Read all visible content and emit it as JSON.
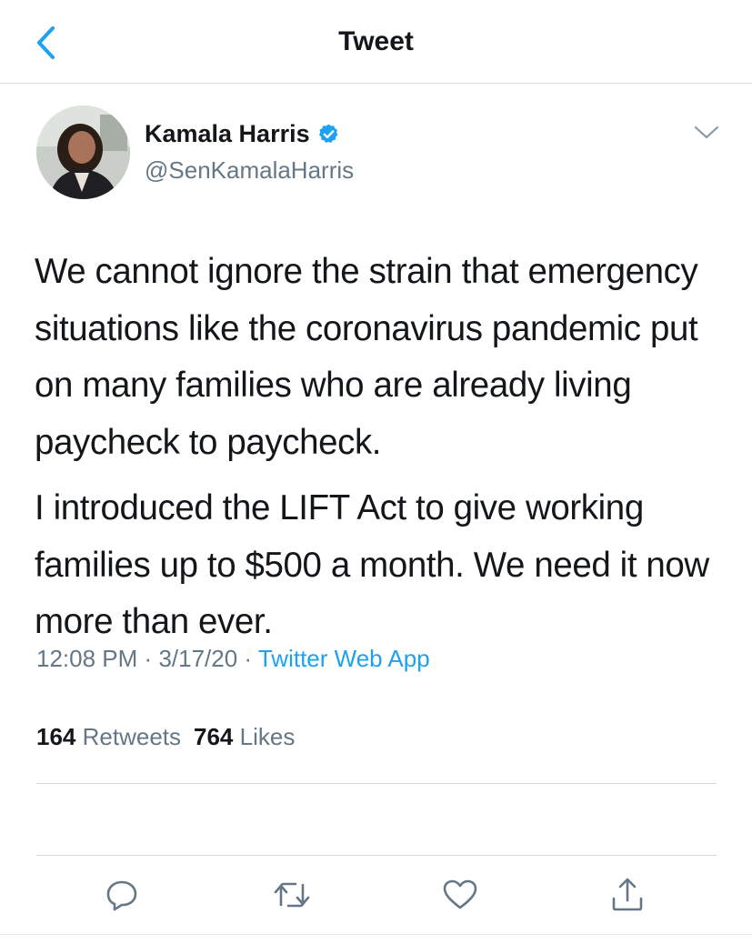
{
  "header": {
    "title": "Tweet",
    "back_icon": "chevron-left-icon"
  },
  "author": {
    "display_name": "Kamala Harris",
    "handle": "@SenKamalaHarris",
    "verified": true
  },
  "tweet": {
    "paragraphs": [
      "We cannot ignore the strain that emergency situations like the coronavirus pandemic put on many families who are already living paycheck to paycheck.",
      "I introduced the LIFT Act to give working families up to $500 a month. We need it now more than ever."
    ],
    "time": "12:08 PM",
    "date": "3/17/20",
    "separator": "·",
    "source": "Twitter Web App"
  },
  "stats": {
    "retweets_count": "164",
    "retweets_label": "Retweets",
    "likes_count": "764",
    "likes_label": "Likes"
  },
  "actions": [
    "reply-icon",
    "retweet-icon",
    "like-icon",
    "share-icon"
  ],
  "colors": {
    "accent": "#1da1f2",
    "secondary_text": "#657786",
    "primary_text": "#14171a",
    "divider": "#d6d9dc"
  }
}
